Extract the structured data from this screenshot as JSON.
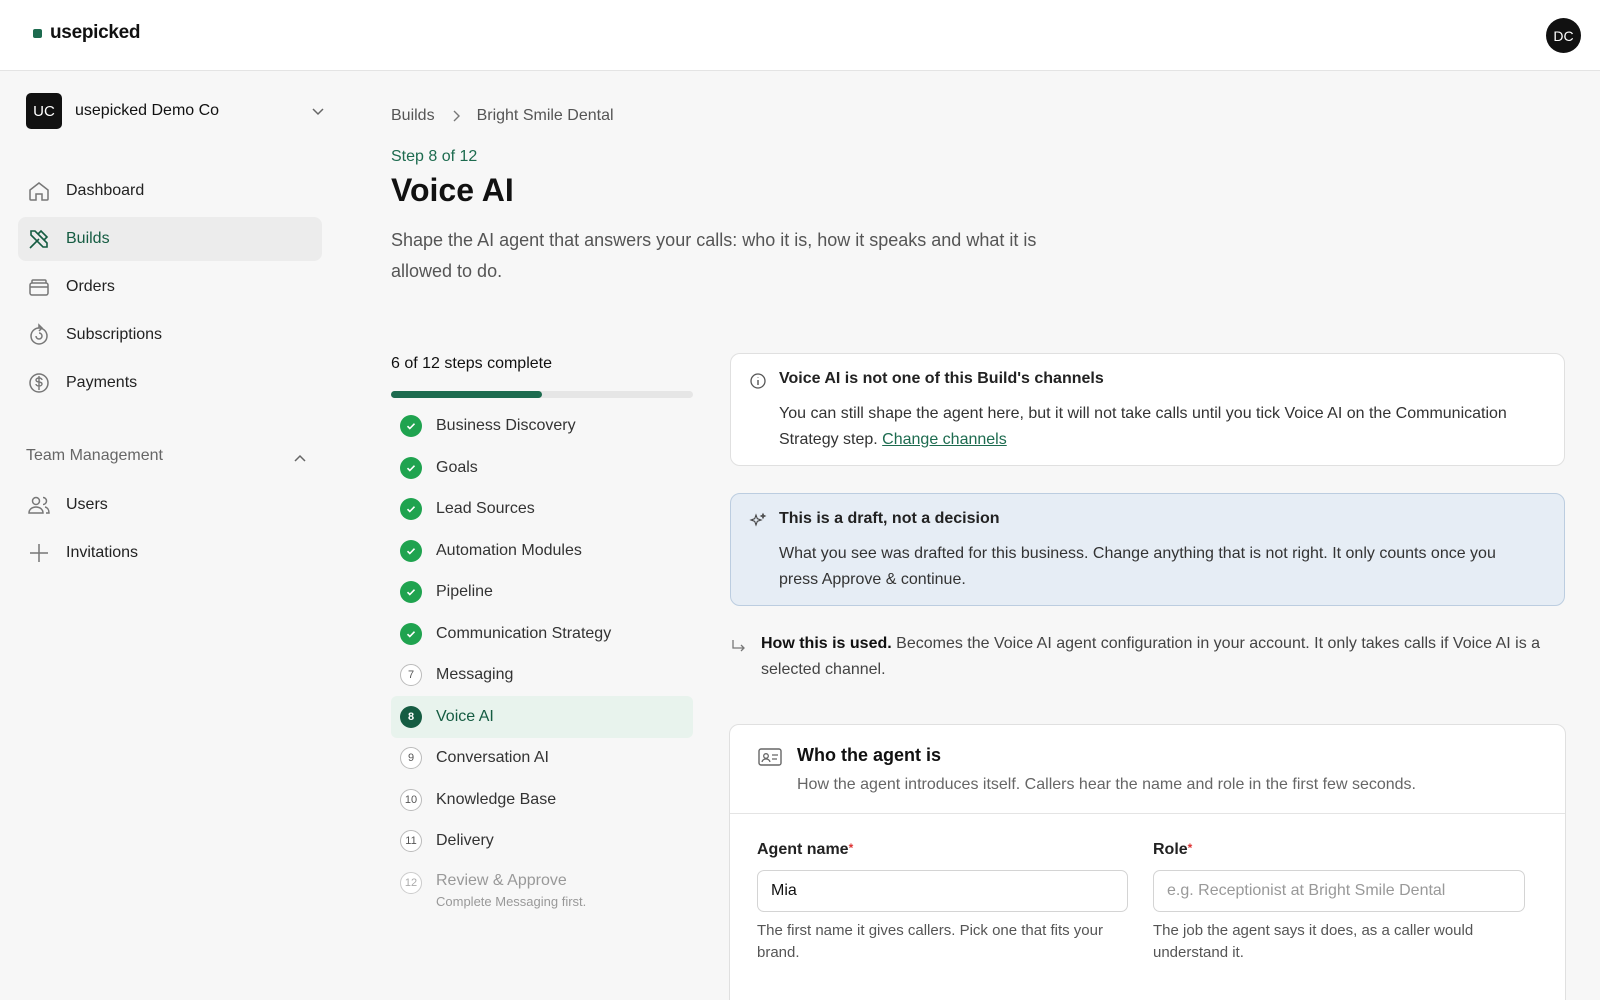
{
  "brand": {
    "name": "usepicked"
  },
  "user": {
    "initials": "DC"
  },
  "org": {
    "initials": "UC",
    "name": "usepicked Demo Co"
  },
  "nav": [
    {
      "label": "Dashboard",
      "icon": "home-icon"
    },
    {
      "label": "Builds",
      "icon": "tools-icon"
    },
    {
      "label": "Orders",
      "icon": "box-icon"
    },
    {
      "label": "Subscriptions",
      "icon": "refresh-icon"
    },
    {
      "label": "Payments",
      "icon": "dollar-icon"
    }
  ],
  "team": {
    "title": "Team Management",
    "items": [
      {
        "label": "Users",
        "icon": "users-icon"
      },
      {
        "label": "Invitations",
        "icon": "plus-icon"
      }
    ]
  },
  "breadcrumb": [
    "Builds",
    "Bright Smile Dental"
  ],
  "header": {
    "step": "Step 8 of 12",
    "title": "Voice AI",
    "subtitle": "Shape the AI agent that answers your calls: who it is, how it speaks and what it is allowed to do."
  },
  "progress": {
    "label": "6 of 12 steps complete",
    "completed": 6,
    "total": 12
  },
  "steps": [
    {
      "n": "1",
      "label": "Business Discovery",
      "state": "done"
    },
    {
      "n": "2",
      "label": "Goals",
      "state": "done"
    },
    {
      "n": "3",
      "label": "Lead Sources",
      "state": "done"
    },
    {
      "n": "4",
      "label": "Automation Modules",
      "state": "done"
    },
    {
      "n": "5",
      "label": "Pipeline",
      "state": "done"
    },
    {
      "n": "6",
      "label": "Communication Strategy",
      "state": "done"
    },
    {
      "n": "7",
      "label": "Messaging",
      "state": "todo"
    },
    {
      "n": "8",
      "label": "Voice AI",
      "state": "current"
    },
    {
      "n": "9",
      "label": "Conversation AI",
      "state": "todo"
    },
    {
      "n": "10",
      "label": "Knowledge Base",
      "state": "todo"
    },
    {
      "n": "11",
      "label": "Delivery",
      "state": "todo"
    },
    {
      "n": "12",
      "label": "Review & Approve",
      "state": "disabled",
      "sub": "Complete Messaging first."
    }
  ],
  "notice": {
    "title": "Voice AI is not one of this Build's channels",
    "body": "You can still shape the agent here, but it will not take calls until you tick Voice AI on the Communication Strategy step.",
    "link": "Change channels"
  },
  "draft": {
    "title": "This is a draft, not a decision",
    "body": "What you see was drafted for this business. Change anything that is not right. It only counts once you press Approve & continue."
  },
  "usage": {
    "lead": "How this is used.",
    "text": "Becomes the Voice AI agent configuration in your account. It only takes calls if Voice AI is a selected channel."
  },
  "agent": {
    "title": "Who the agent is",
    "desc": "How the agent introduces itself. Callers hear the name and role in the first few seconds.",
    "name": {
      "label": "Agent name",
      "value": "Mia",
      "help": "The first name it gives callers. Pick one that fits your brand."
    },
    "role": {
      "label": "Role",
      "value": "",
      "placeholder": "e.g. Receptionist at Bright Smile Dental",
      "help": "The job the agent says it does, as a caller would understand it."
    }
  },
  "colors": {
    "accent": "#1d6b4f",
    "done": "#1fa34f",
    "info_bg": "#e6edf5"
  }
}
